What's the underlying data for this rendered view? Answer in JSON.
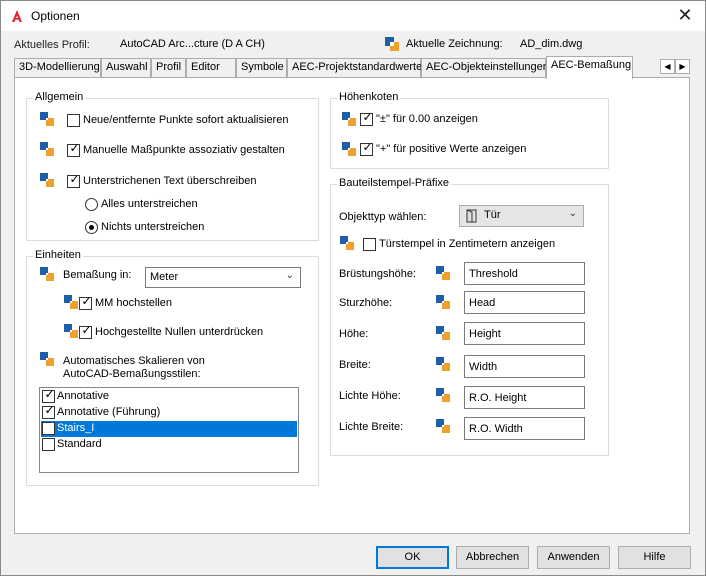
{
  "window": {
    "title": "Optionen",
    "profile_label": "Aktuelles Profil:",
    "profile_value": "AutoCAD Arc...cture (D A CH)",
    "drawing_label": "Aktuelle Zeichnung:",
    "drawing_value": "AD_dim.dwg"
  },
  "tabs": [
    {
      "label": "3D-Modellierung"
    },
    {
      "label": "Auswahl"
    },
    {
      "label": "Profil"
    },
    {
      "label": "Editor"
    },
    {
      "label": "Symbole"
    },
    {
      "label": "AEC-Projektstandardwerte"
    },
    {
      "label": "AEC-Objekteinstellungen"
    },
    {
      "label": "AEC-Bemaßung"
    }
  ],
  "active_tab": "AEC-Bemaßung",
  "allgemein": {
    "title": "Allgemein",
    "update_points": {
      "label": "Neue/entfernte Punkte sofort aktualisieren",
      "checked": false
    },
    "associative": {
      "label": "Manuelle Maßpunkte assoziativ gestalten",
      "checked": true
    },
    "override_underline": {
      "label": "Unterstrichenen Text überschreiben",
      "checked": true
    },
    "underline_all": {
      "label": "Alles unterstreichen",
      "selected": false
    },
    "underline_none": {
      "label": "Nichts unterstreichen",
      "selected": true
    }
  },
  "einheiten": {
    "title": "Einheiten",
    "dimension_label": "Bemaßung in:",
    "dimension_value": "Meter",
    "mm_superscript": {
      "label": "MM hochstellen",
      "checked": true
    },
    "suppress_zeros": {
      "label": "Hochgestellte Nullen unterdrücken",
      "checked": true
    },
    "auto_scale_label_1": "Automatisches Skalieren von",
    "auto_scale_label_2": "AutoCAD-Bemaßungsstilen:",
    "styles": [
      {
        "label": "Annotative",
        "checked": true,
        "selected": false
      },
      {
        "label": "Annotative (Führung)",
        "checked": true,
        "selected": false
      },
      {
        "label": "Stairs_I",
        "checked": true,
        "selected": true
      },
      {
        "label": "Standard",
        "checked": false,
        "selected": false
      }
    ]
  },
  "hoehenkoten": {
    "title": "Höhenkoten",
    "plusminus": {
      "label": "\"±\" für 0.00 anzeigen",
      "checked": true
    },
    "plus": {
      "label": "\"+\" für positive Werte anzeigen",
      "checked": true
    }
  },
  "bauteilstempel": {
    "title": "Bauteilstempel-Präfixe",
    "objtype_label": "Objekttyp wählen:",
    "objtype_value": "Tür",
    "door_stamp_cm": {
      "label": "Türstempel in Zentimetern anzeigen",
      "checked": false
    },
    "fields": [
      {
        "label": "Brüstungshöhe:",
        "value": "Threshold"
      },
      {
        "label": "Sturzhöhe:",
        "value": "Head"
      },
      {
        "label": "Höhe:",
        "value": "Height"
      },
      {
        "label": "Breite:",
        "value": "Width"
      },
      {
        "label": "Lichte Höhe:",
        "value": "R.O. Height"
      },
      {
        "label": "Lichte Breite:",
        "value": "R.O. Width"
      }
    ]
  },
  "buttons": {
    "ok": "OK",
    "cancel": "Abbrechen",
    "apply": "Anwenden",
    "help": "Hilfe"
  },
  "colors": {
    "accent": "#0078d7",
    "app_icon": "#e0262e"
  }
}
